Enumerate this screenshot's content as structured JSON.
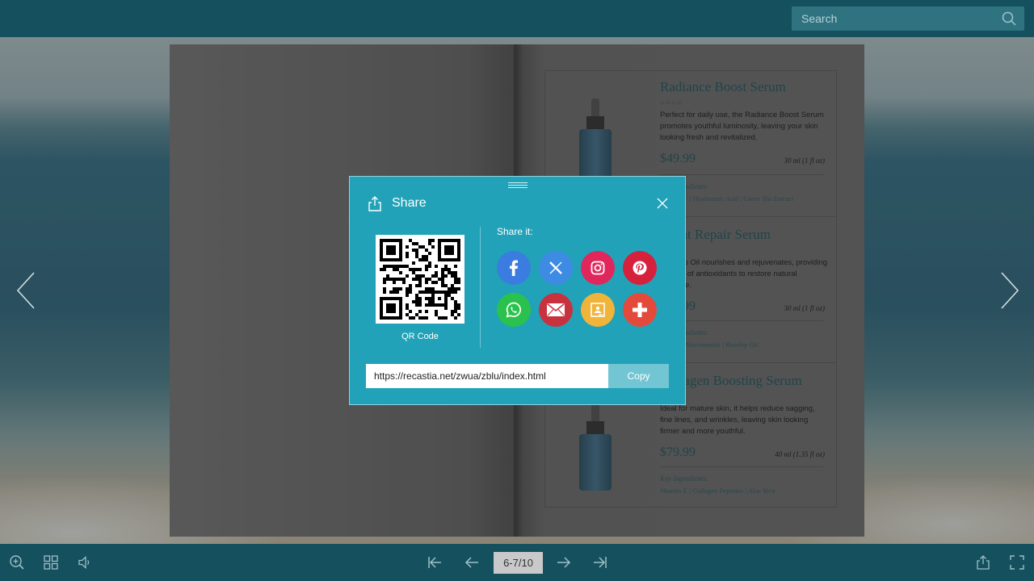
{
  "search": {
    "placeholder": "Search"
  },
  "book": {
    "products": [
      {
        "name": "Radiance Boost Serum",
        "rating": "○○○○",
        "description": "Perfect for daily use, the Radiance Boost Serum promotes youthful luminosity, leaving your skin looking fresh and revitalized.",
        "price": "$49.99",
        "size": "30 ml (1 fl oz)",
        "key_label": "Key Ingredients:",
        "key_ingredients": "Vitamin C | Hyaluronic Acid | Green Tea Extract"
      },
      {
        "name": "Night Repair Serum",
        "rating": "○○○○",
        "description": "Rosehip Oil nourishes and rejuvenates, providing a boost of antioxidants to restore natural radiance.",
        "price": "$59.99",
        "size": "30 ml (1 fl oz)",
        "key_label": "Key Ingredients:",
        "key_ingredients": "Retinol | Niacinamide | Rosehip Oil"
      },
      {
        "name": "Collagen Boosting Serum",
        "rating": "○○○○",
        "description": "Ideal for mature skin, it helps reduce sagging, fine lines, and wrinkles, leaving skin looking firmer and more youthful.",
        "price": "$79.99",
        "size": "40 ml (1.35 fl oz)",
        "key_label": "Key Ingredients:",
        "key_ingredients": "Vitamin E | Collagen Peptides | Aloe Vera"
      }
    ]
  },
  "dialog": {
    "title": "Share",
    "qr_label": "QR Code",
    "share_label": "Share it:",
    "url": "https://recastia.net/zwua/zblu/index.html",
    "copy_label": "Copy",
    "socials": [
      {
        "name": "facebook-icon",
        "color": "#3b7ce0"
      },
      {
        "name": "x-icon",
        "color": "#3d8be3"
      },
      {
        "name": "instagram-icon",
        "color": "#e0265b"
      },
      {
        "name": "pinterest-icon",
        "color": "#d6213c"
      },
      {
        "name": "whatsapp-icon",
        "color": "#2ac24c"
      },
      {
        "name": "email-icon",
        "color": "#c8323f"
      },
      {
        "name": "google-classroom-icon",
        "color": "#f0b43a"
      },
      {
        "name": "more-share-icon",
        "color": "#e44a3b"
      }
    ]
  },
  "toolbar": {
    "page_indicator": "6-7/10"
  },
  "colors": {
    "bar": "#15505e",
    "dialog": "#21a2b8",
    "accent": "#72c5d2"
  }
}
